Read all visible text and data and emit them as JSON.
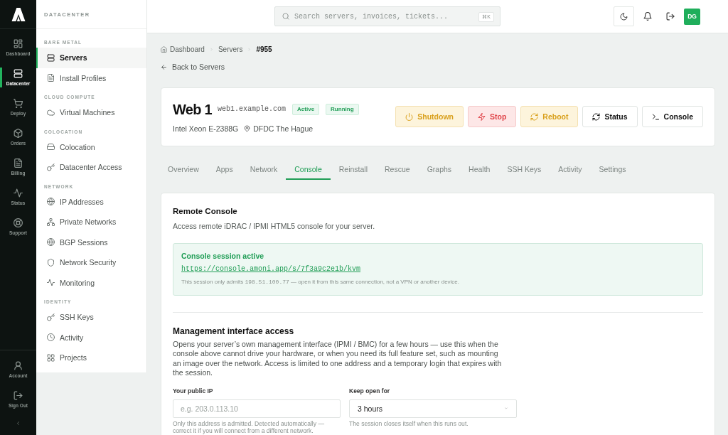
{
  "rail": {
    "items": [
      {
        "label": "Dashboard",
        "selected": false
      },
      {
        "label": "Datacenter",
        "selected": true
      },
      {
        "label": "Deploy",
        "selected": false
      },
      {
        "label": "Orders",
        "selected": false
      },
      {
        "label": "Billing",
        "selected": false
      },
      {
        "label": "Status",
        "selected": false
      },
      {
        "label": "Support",
        "selected": false
      }
    ],
    "bottom_items": [
      {
        "label": "Account"
      },
      {
        "label": "Sign Out"
      }
    ]
  },
  "sidebar": {
    "title": "DATACENTER",
    "sections": [
      {
        "heading": "BARE METAL",
        "items": [
          {
            "label": "Servers",
            "selected": true
          },
          {
            "label": "Install Profiles",
            "selected": false
          }
        ]
      },
      {
        "heading": "CLOUD COMPUTE",
        "items": [
          {
            "label": "Virtual Machines",
            "selected": false
          }
        ]
      },
      {
        "heading": "COLOCATION",
        "items": [
          {
            "label": "Colocation",
            "selected": false
          },
          {
            "label": "Datacenter Access",
            "selected": false
          }
        ]
      },
      {
        "heading": "NETWORK",
        "items": [
          {
            "label": "IP Addresses",
            "selected": false
          },
          {
            "label": "Private Networks",
            "selected": false
          },
          {
            "label": "BGP Sessions",
            "selected": false
          },
          {
            "label": "Network Security",
            "selected": false
          },
          {
            "label": "Monitoring",
            "selected": false
          }
        ]
      },
      {
        "heading": "IDENTITY",
        "items": [
          {
            "label": "SSH Keys",
            "selected": false
          },
          {
            "label": "Activity",
            "selected": false
          },
          {
            "label": "Projects",
            "selected": false
          }
        ]
      }
    ]
  },
  "topbar": {
    "search": {
      "placeholder": "Search servers, invoices, tickets...",
      "shortcut": "⌘K"
    },
    "avatar": "DG"
  },
  "breadcrumb": [
    {
      "label": "Dashboard",
      "current": false
    },
    {
      "label": "Servers",
      "current": false
    },
    {
      "label": "#955",
      "current": true
    }
  ],
  "back_link": "Back to Servers",
  "server": {
    "name": "Web 1",
    "hostname": "web1.example.com",
    "badges": [
      "Active",
      "Running"
    ],
    "cpu": "Intel Xeon E-2388G",
    "location": "DFDC The Hague",
    "actions": [
      {
        "label": "Shutdown",
        "kind": "warning"
      },
      {
        "label": "Stop",
        "kind": "danger"
      },
      {
        "label": "Reboot",
        "kind": "warning"
      },
      {
        "label": "Status",
        "kind": "default"
      },
      {
        "label": "Console",
        "kind": "default"
      }
    ]
  },
  "tabs": [
    {
      "label": "Overview",
      "selected": false
    },
    {
      "label": "Apps",
      "selected": false
    },
    {
      "label": "Network",
      "selected": false
    },
    {
      "label": "Console",
      "selected": true
    },
    {
      "label": "Reinstall",
      "selected": false
    },
    {
      "label": "Rescue",
      "selected": false
    },
    {
      "label": "Graphs",
      "selected": false
    },
    {
      "label": "Health",
      "selected": false
    },
    {
      "label": "SSH Keys",
      "selected": false
    },
    {
      "label": "Activity",
      "selected": false
    },
    {
      "label": "Settings",
      "selected": false
    }
  ],
  "remote_console": {
    "title": "Remote Console",
    "description": "Access remote iDRAC / IPMI HTML5 console for your server.",
    "session": {
      "title": "Console session active",
      "url": "https://console.amoni.app/s/7f3a9c2e1b/kvm",
      "note_before": "This session only admits",
      "ip": "198.51.100.77",
      "note_after": "— open it from this same connection, not a VPN or another device."
    }
  },
  "management": {
    "title": "Management interface access",
    "description": "Opens your server’s own management interface (IPMI / BMC) for a few hours — use this when the console above cannot drive your hardware, or when you need its full feature set, such as mounting an image over the network. Access is limited to one address and a temporary login that expires with the session.",
    "fields": [
      {
        "kind": "input",
        "label": "Your public IP",
        "placeholder": "e.g. 203.0.113.10",
        "hint": "Only this address is admitted. Detected automatically — correct it if you will connect from a different network."
      },
      {
        "kind": "select",
        "label": "Keep open for",
        "value": "3 hours",
        "hint": "The session closes itself when this runs out."
      }
    ]
  }
}
